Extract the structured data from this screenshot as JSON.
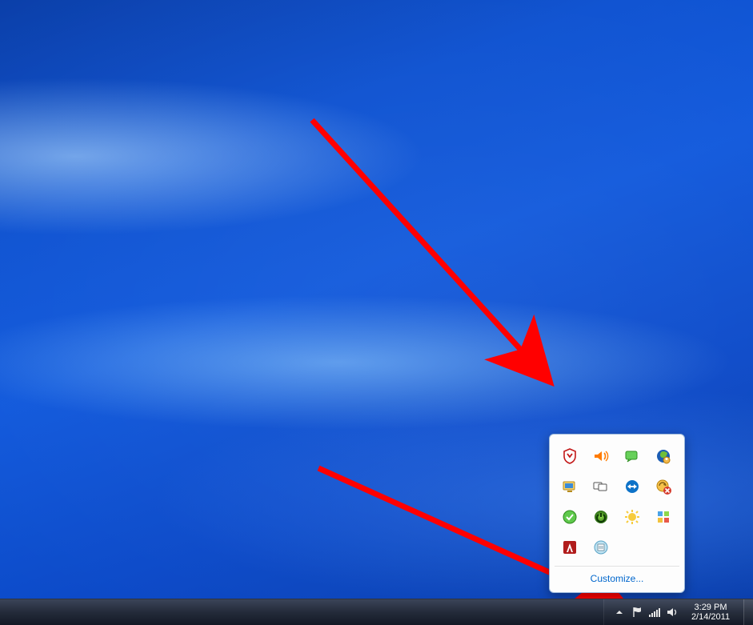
{
  "clock": {
    "time": "3:29 PM",
    "date": "2/14/2011"
  },
  "popup": {
    "customize_label": "Customize...",
    "icons": [
      "mcafee-shield-icon",
      "volume-mixer-icon",
      "chat-icon",
      "user-globe-icon",
      "display-icon",
      "dual-monitor-icon",
      "team-viewer-icon",
      "update-error-icon",
      "check-ok-icon",
      "power-icon",
      "weather-sun-icon",
      "widgets-icon",
      "adobe-icon",
      "notes-icon"
    ]
  }
}
